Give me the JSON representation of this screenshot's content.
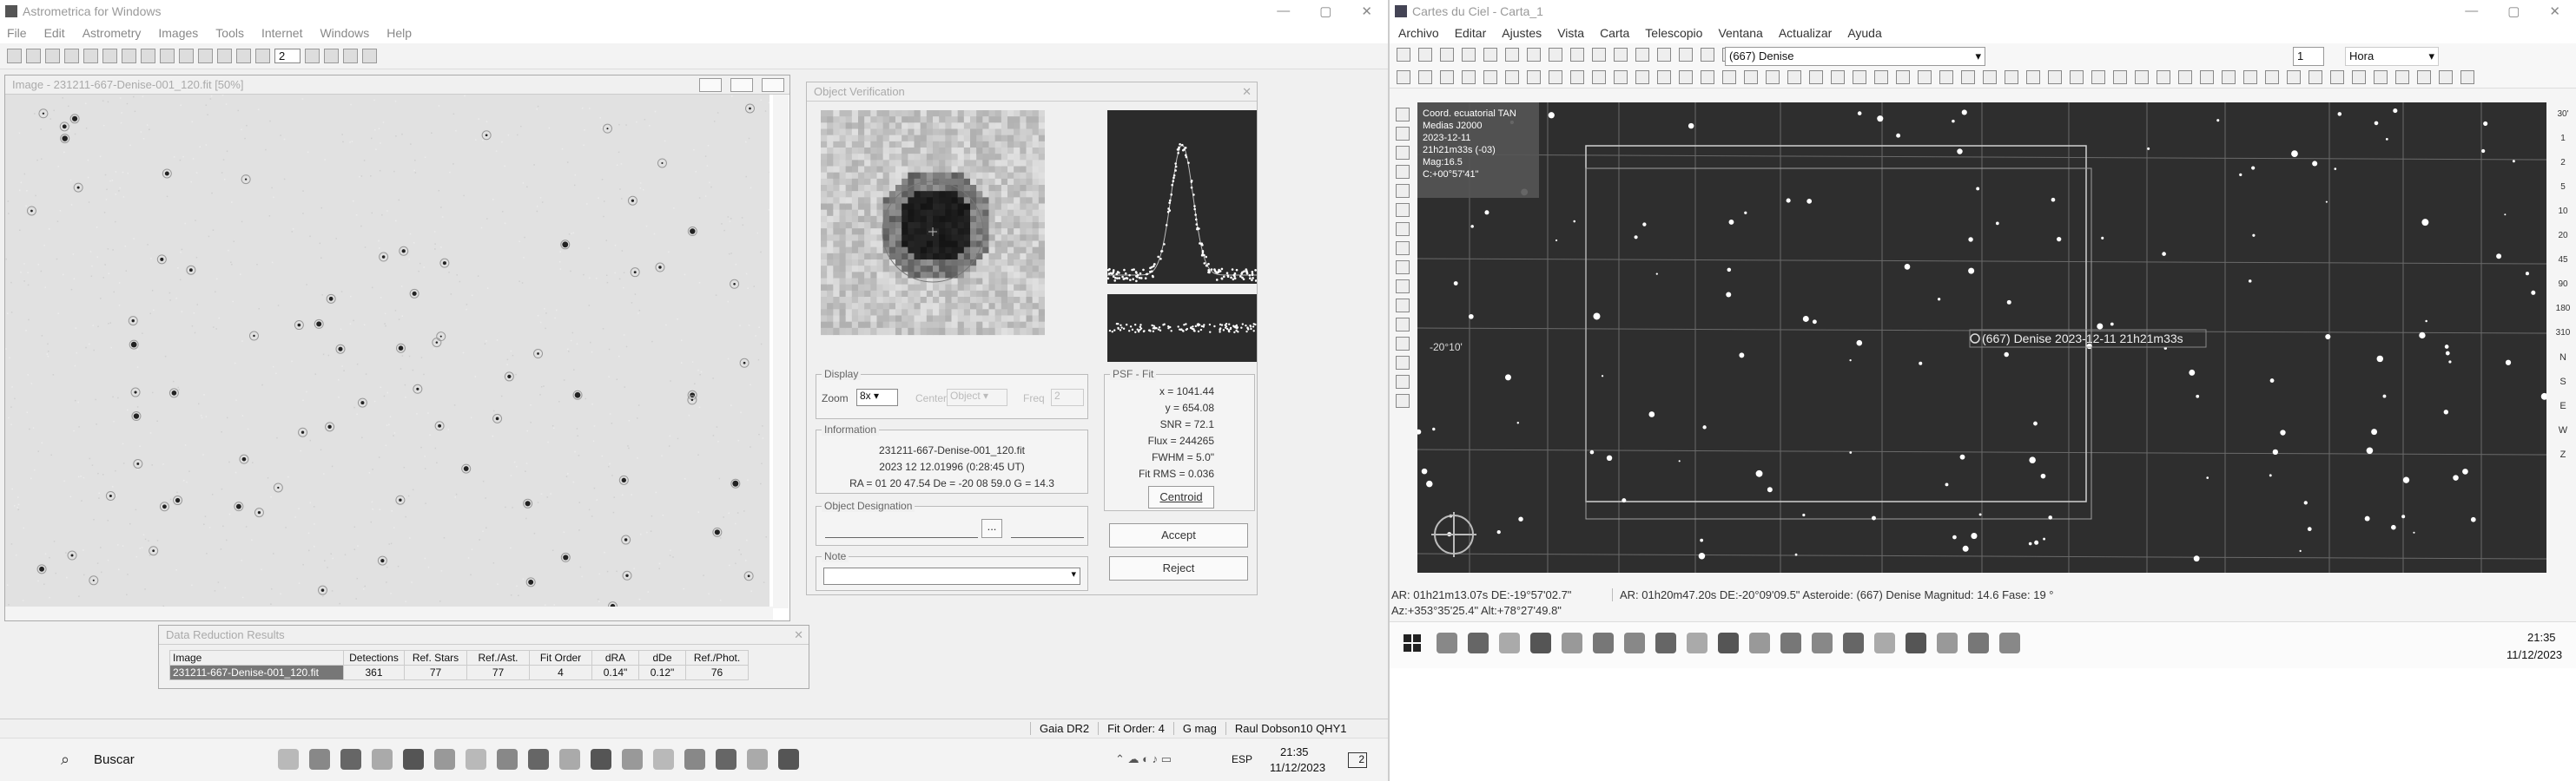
{
  "left": {
    "title": "Astrometrica for Windows",
    "menu": [
      "File",
      "Edit",
      "Astrometry",
      "Images",
      "Tools",
      "Internet",
      "Windows",
      "Help"
    ],
    "zoom_spin": "2",
    "image_window": {
      "title": "Image - 231211-667-Denise-001_120.fit [50%]"
    },
    "verify": {
      "title": "Object Verification",
      "psf_fit_label": "PSF - Fit",
      "psf": [
        "x = 1041.44",
        "y = 654.08",
        "SNR = 72.1",
        "Flux = 244265",
        "FWHM = 5.0\"",
        "Fit RMS = 0.036"
      ],
      "centroid": "Centroid",
      "display_label": "Display",
      "zoom_label": "Zoom",
      "zoom_value": "8x",
      "center_label": "Center",
      "center_value": "Object",
      "freq_label": "Freq",
      "freq_value": "2",
      "info_label": "Information",
      "info": [
        "231211-667-Denise-001_120.fit",
        "2023 12 12.01996 (0:28:45 UT)",
        "RA = 01 20 47.54   De = -20 08 59.0   G = 14.3"
      ],
      "designation_label": "Object Designation",
      "ellipsis": "...",
      "note_label": "Note",
      "accept": "Accept",
      "reject": "Reject"
    },
    "reduction": {
      "title": "Data Reduction Results",
      "headers": [
        "Image",
        "Detections",
        "Ref. Stars",
        "Ref./Ast.",
        "Fit Order",
        "dRA",
        "dDe",
        "Ref./Phot."
      ],
      "row": [
        "231211-667-Denise-001_120.fit",
        "361",
        "77",
        "77",
        "4",
        "0.14\"",
        "0.12\"",
        "76"
      ]
    },
    "status": [
      "Gaia DR2",
      "Fit Order: 4",
      "G mag",
      "Raul  Dobson10 QHY1"
    ],
    "taskbar": {
      "search": "Buscar",
      "lang": "ESP",
      "time": "21:35",
      "date": "11/12/2023",
      "badge": "2"
    }
  },
  "right": {
    "title": "Cartes du Ciel - Carta_1",
    "menu": [
      "Archivo",
      "Editar",
      "Ajustes",
      "Vista",
      "Carta",
      "Telescopio",
      "Ventana",
      "Actualizar",
      "Ayuda"
    ],
    "object_select": "(667) Denise",
    "field_value": "1",
    "time_select": "Hora",
    "info_box": [
      "Coord. ecuatorial TAN",
      "Medias J2000",
      "2023-12-11",
      "21h21m33s (-03)",
      "Mag:16.5",
      "C:+00°57'41\""
    ],
    "dec_label": "-20°10'",
    "asteroid_label": "(667) Denise 2023-12-11 21h21m33s",
    "scale": [
      "30'",
      "1",
      "2",
      "5",
      "10",
      "20",
      "45",
      "90",
      "180",
      "310"
    ],
    "cardinal": [
      "N",
      "S",
      "E",
      "W",
      "Z"
    ],
    "status1": "AR: 01h21m13.07s DE:-19°57'02.7\"",
    "status2": "Az:+353°35'25.4\" Alt:+78°27'49.8\"",
    "status3": "AR: 01h20m47.20s DE:-20°09'09.5\"  Asteroide: (667) Denise  Magnitud: 14.6  Fase: 19 °",
    "time": "21:35",
    "date": "11/12/2023"
  }
}
